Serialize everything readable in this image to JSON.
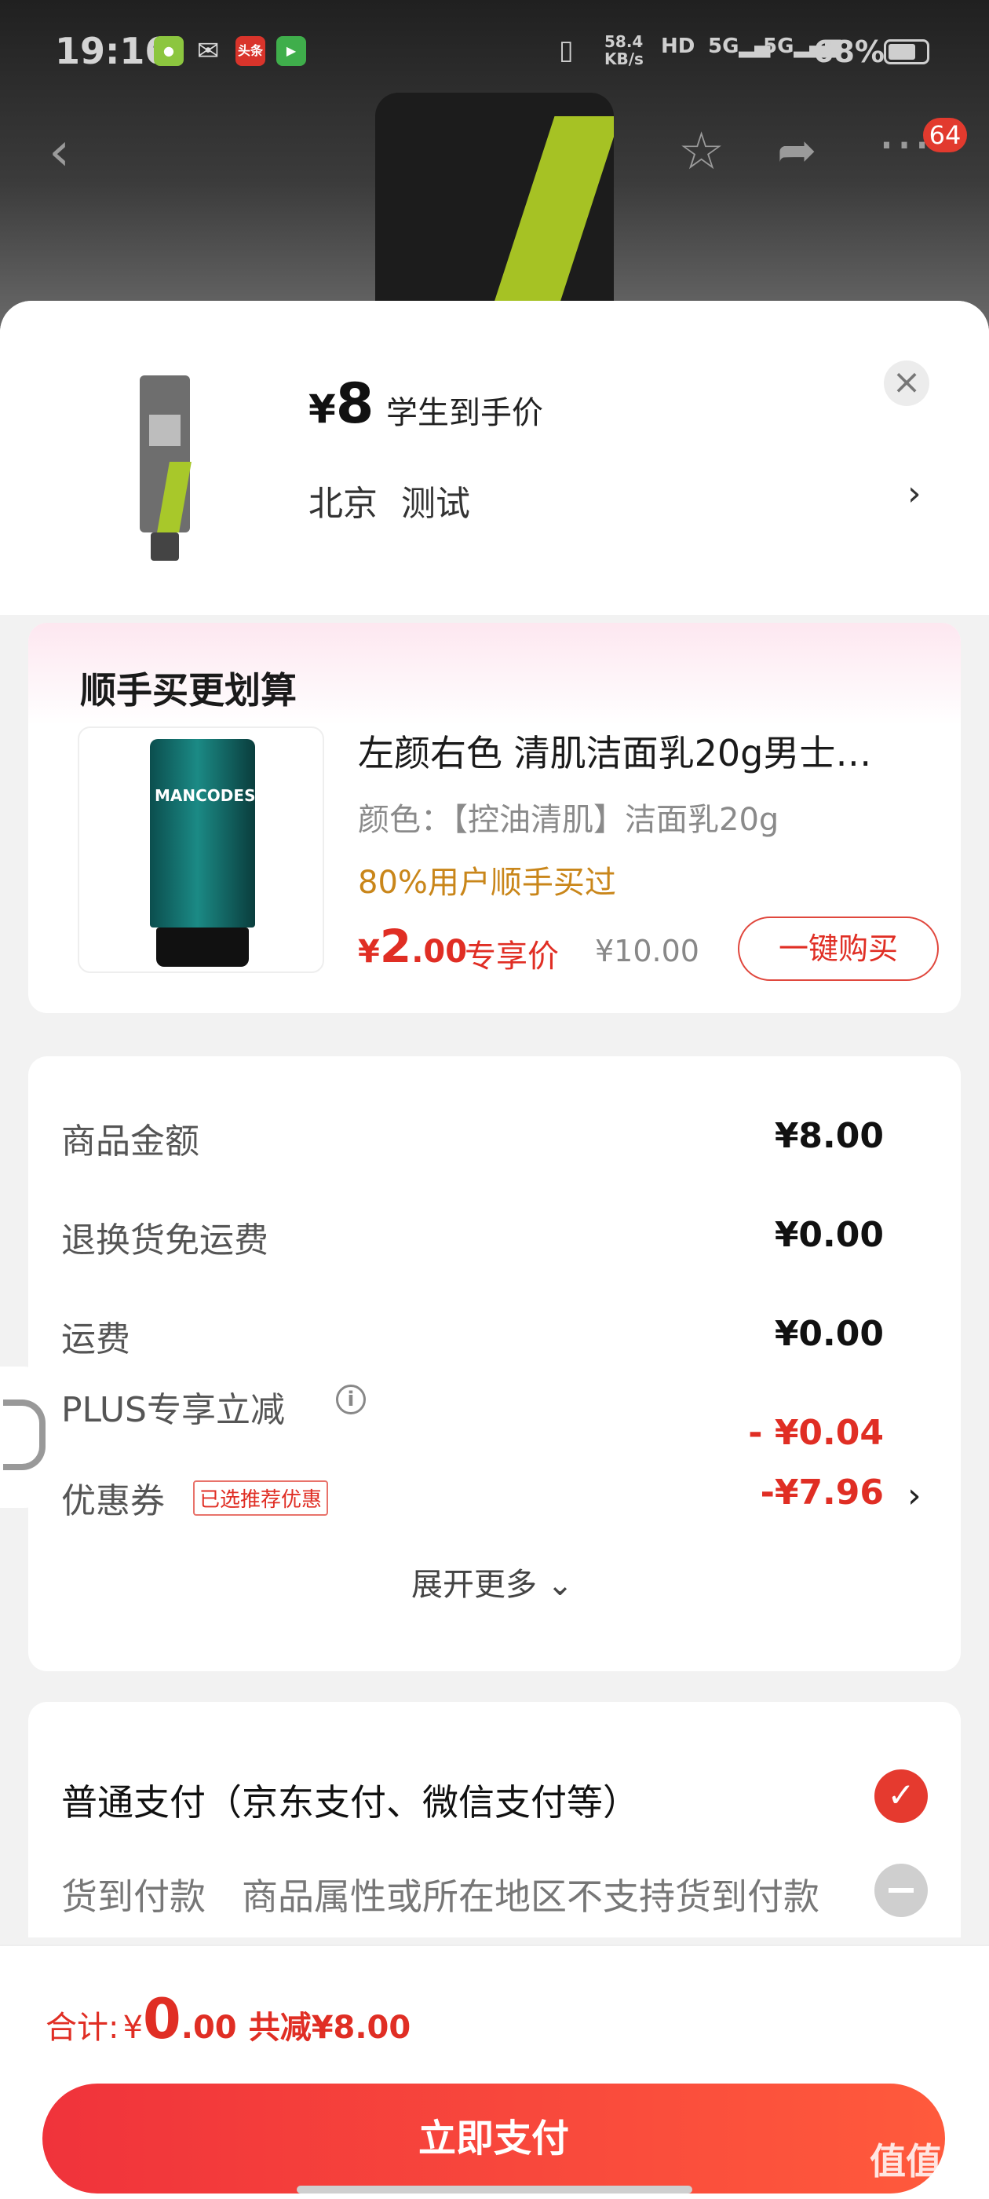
{
  "status_bar": {
    "time": "19:16",
    "net_speed": "58.4 KB/s",
    "battery": "68%",
    "app_icon_toutiao": "头条"
  },
  "nav": {
    "cart_badge": "64"
  },
  "sheet": {
    "price_symbol": "¥",
    "price_value": "8",
    "price_note": "学生到手价",
    "address": "北京 测试",
    "close_icon": "close-icon",
    "address_arrow": "›"
  },
  "upsell": {
    "title": "顺手买更划算",
    "product_name": "左颜右色 清肌洁面乳20g男士…",
    "spec": "颜色：【控油清肌】洁面乳20g",
    "popularity": "80%用户顺手买过",
    "price_symbol": "¥",
    "price_int": "2",
    "price_dec": ".00",
    "price_tag": "专享价",
    "original_price": "¥10.00",
    "buy_button": "一键购买",
    "image_brand_text": "MANCODES"
  },
  "summary": {
    "rows": [
      {
        "label": "商品金额",
        "value": "¥8.00"
      },
      {
        "label": "退换货免运费",
        "value": "¥0.00"
      },
      {
        "label": "运费",
        "value": "¥0.00"
      },
      {
        "label": "PLUS专享立减",
        "value": "- ¥0.04"
      },
      {
        "label": "优惠券",
        "value": "-¥7.96"
      }
    ],
    "coupon_tag": "已选推荐优惠",
    "expand_more": "展开更多 ⌄"
  },
  "payment": {
    "normal_label": "普通支付（京东支付、微信支付等）",
    "cod_label": "货到付款",
    "cod_note": "商品属性或所在地区不支持货到付款"
  },
  "footer": {
    "total_label": "合计:",
    "total_symbol": "¥",
    "total_int": "0",
    "total_dec": ".00",
    "saved": "共减¥8.00",
    "pay_button": "立即支付"
  },
  "watermark": "值值值",
  "colors": {
    "accent_red": "#e02e24",
    "pay_button": "#f0333b",
    "popularity_gold": "#c9861a"
  }
}
